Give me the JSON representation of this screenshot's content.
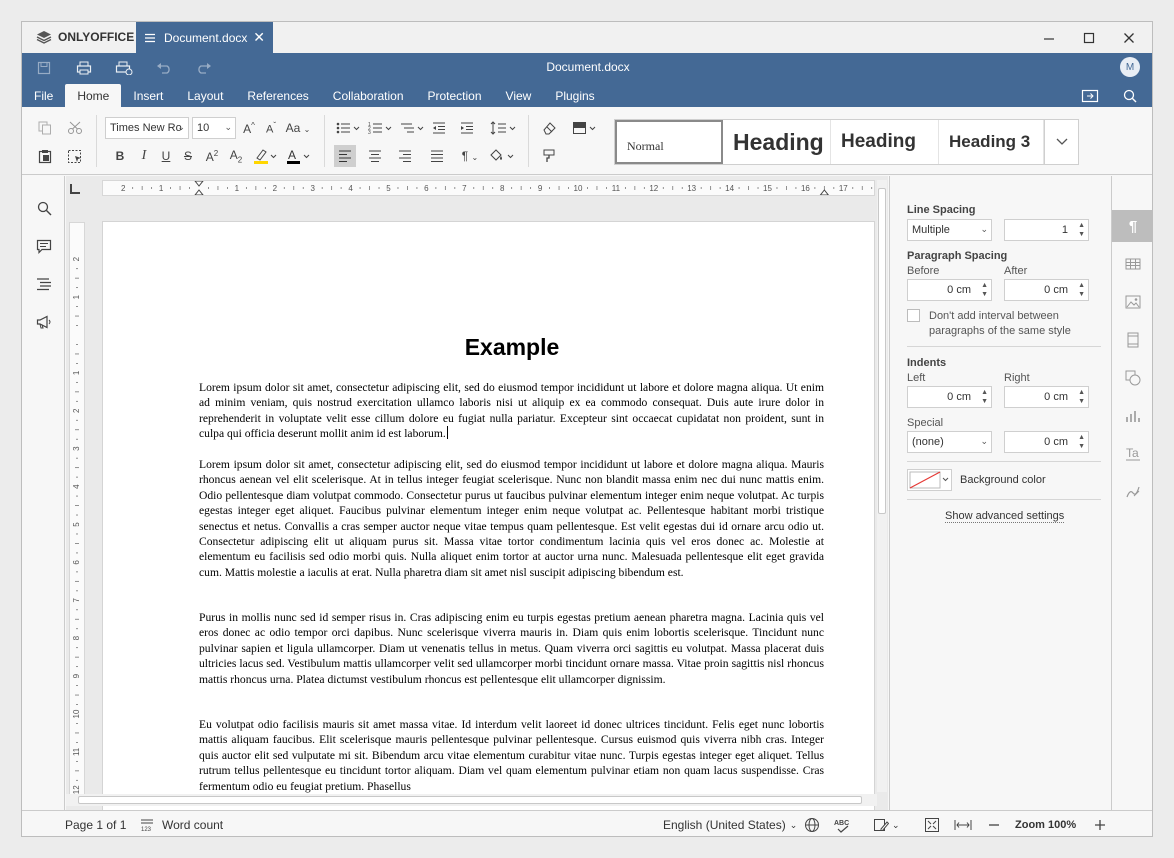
{
  "app": {
    "brand": "ONLYOFFICE",
    "tab_title": "Document.docx",
    "window_title": "Document.docx",
    "avatar": "M"
  },
  "menu": {
    "tabs": [
      "File",
      "Home",
      "Insert",
      "Layout",
      "References",
      "Collaboration",
      "Protection",
      "View",
      "Plugins"
    ],
    "active": "Home"
  },
  "toolbar": {
    "font_name": "Times New Ro",
    "font_size": "10",
    "styles": [
      "Normal",
      "Heading",
      "Heading",
      "Heading 3"
    ]
  },
  "document": {
    "heading": "Example",
    "paragraphs": [
      "Lorem ipsum dolor sit amet, consectetur adipiscing elit, sed do eiusmod tempor incididunt ut labore et dolore magna aliqua. Ut enim ad minim veniam, quis nostrud exercitation ullamco laboris nisi ut aliquip ex ea commodo consequat. Duis aute irure dolor in reprehenderit in voluptate velit esse cillum dolore eu fugiat nulla pariatur. Excepteur sint occaecat cupidatat non proident, sunt in culpa qui officia deserunt mollit anim id est laborum.",
      "Lorem ipsum dolor sit amet, consectetur adipiscing elit, sed do eiusmod tempor incididunt ut labore et dolore magna aliqua. Mauris rhoncus aenean vel elit scelerisque. At in tellus integer feugiat scelerisque. Nunc non blandit massa enim nec dui nunc mattis enim. Odio pellentesque diam volutpat commodo. Consectetur purus ut faucibus pulvinar elementum integer enim neque volutpat. Ac turpis egestas integer eget aliquet. Faucibus pulvinar elementum integer enim neque volutpat ac. Pellentesque habitant morbi tristique senectus et netus. Convallis a cras semper auctor neque vitae tempus quam pellentesque. Est velit egestas dui id ornare arcu odio ut. Consectetur adipiscing elit ut aliquam purus sit. Massa vitae tortor condimentum lacinia quis vel eros donec ac. Molestie at elementum eu facilisis sed odio morbi quis. Nulla aliquet enim tortor at auctor urna nunc. Malesuada pellentesque elit eget gravida cum. Mattis molestie a iaculis at erat. Nulla pharetra diam sit amet nisl suscipit adipiscing bibendum est.",
      "Purus in mollis nunc sed id semper risus in. Cras adipiscing enim eu turpis egestas pretium aenean pharetra magna. Lacinia quis vel eros donec ac odio tempor orci dapibus. Nunc scelerisque viverra mauris in. Diam quis enim lobortis scelerisque. Tincidunt nunc pulvinar sapien et ligula ullamcorper. Diam ut venenatis tellus in metus. Quam viverra orci sagittis eu volutpat. Massa placerat duis ultricies lacus sed. Vestibulum mattis ullamcorper velit sed ullamcorper morbi tincidunt ornare massa. Vitae proin sagittis nisl rhoncus mattis rhoncus urna. Platea dictumst vestibulum rhoncus est pellentesque elit ullamcorper dignissim.",
      "Eu volutpat odio facilisis mauris sit amet massa vitae. Id interdum velit laoreet id donec ultrices tincidunt. Felis eget nunc lobortis mattis aliquam faucibus. Elit scelerisque mauris pellentesque pulvinar pellentesque. Cursus euismod quis viverra nibh cras. Integer quis auctor elit sed vulputate mi sit. Bibendum arcu vitae elementum curabitur vitae nunc. Turpis egestas integer eget aliquet. Tellus rutrum tellus pellentesque eu tincidunt tortor aliquam. Diam vel quam elementum pulvinar etiam non quam lacus suspendisse. Cras fermentum odio eu feugiat pretium. Phasellus"
    ]
  },
  "ruler": {
    "h_labels": [
      "2",
      "1",
      "1",
      "2",
      "3",
      "4",
      "5",
      "6",
      "7",
      "8",
      "9",
      "10",
      "11",
      "12",
      "13",
      "14",
      "15",
      "16",
      "17"
    ],
    "v_labels": [
      "2",
      "1",
      "1",
      "2",
      "3",
      "4",
      "5",
      "6",
      "7",
      "8",
      "9",
      "10",
      "11",
      "12"
    ]
  },
  "right_panel": {
    "line_spacing_label": "Line Spacing",
    "line_spacing_mode": "Multiple",
    "line_spacing_value": "1",
    "paragraph_spacing_label": "Paragraph Spacing",
    "before_label": "Before",
    "after_label": "After",
    "before_value": "0 cm",
    "after_value": "0 cm",
    "dont_add_interval": "Don't add interval between paragraphs of the same style",
    "indents_label": "Indents",
    "left_label": "Left",
    "right_label": "Right",
    "left_value": "0 cm",
    "right_value": "0 cm",
    "special_label": "Special",
    "special_value": "(none)",
    "special_by_value": "0 cm",
    "background_color_label": "Background color",
    "show_advanced": "Show advanced settings"
  },
  "status": {
    "page": "Page 1 of 1",
    "word_count": "Word count",
    "language": "English (United States)",
    "zoom": "Zoom 100%"
  },
  "colors": {
    "accent": "#446995",
    "highlight": "#ffd600",
    "font_color": "#000000"
  }
}
